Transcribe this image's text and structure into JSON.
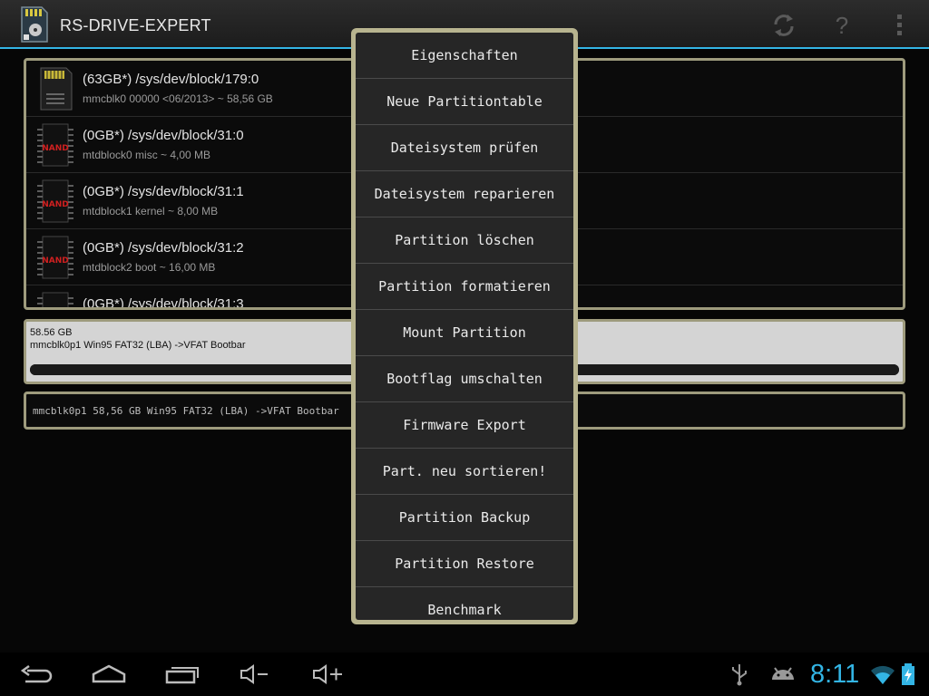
{
  "app": {
    "title": "RS-DRIVE-EXPERT"
  },
  "devices": [
    {
      "path": "(63GB*) /sys/dev/block/179:0",
      "sub": "mmcblk0 00000 <06/2013> ~ 58,56 GB",
      "icon": "sdcard-icon"
    },
    {
      "path": "(0GB*) /sys/dev/block/31:0",
      "sub": "mtdblock0 misc ~ 4,00 MB",
      "icon": "nand-chip-icon"
    },
    {
      "path": "(0GB*) /sys/dev/block/31:1",
      "sub": "mtdblock1 kernel ~ 8,00 MB",
      "icon": "nand-chip-icon"
    },
    {
      "path": "(0GB*) /sys/dev/block/31:2",
      "sub": "mtdblock2 boot ~ 16,00 MB",
      "icon": "nand-chip-icon"
    },
    {
      "path": "(0GB*) /sys/dev/block/31:3",
      "sub": "",
      "icon": "nand-chip-icon"
    }
  ],
  "nand_label": "NAND",
  "partition": {
    "size": "58.56 GB",
    "desc": "mmcblk0p1 Win95 FAT32 (LBA) ->VFAT Bootbar",
    "usage_fraction": 1.0
  },
  "info": {
    "text": "mmcblk0p1 58,56 GB Win95 FAT32 (LBA) ->VFAT Bootbar"
  },
  "menu": {
    "items": [
      "Eigenschaften",
      "Neue Partitiontable",
      "Dateisystem prüfen",
      "Dateisystem reparieren",
      "Partition löschen",
      "Partition formatieren",
      "Mount Partition",
      "Bootflag umschalten",
      "Firmware Export",
      "Part. neu sortieren!",
      "Partition Backup",
      "Partition Restore",
      "Benchmark"
    ]
  },
  "status": {
    "clock": "8:11"
  },
  "colors": {
    "accent": "#33b5e5",
    "frame": "#9e9b7d",
    "menu_border": "#b8b48f"
  }
}
